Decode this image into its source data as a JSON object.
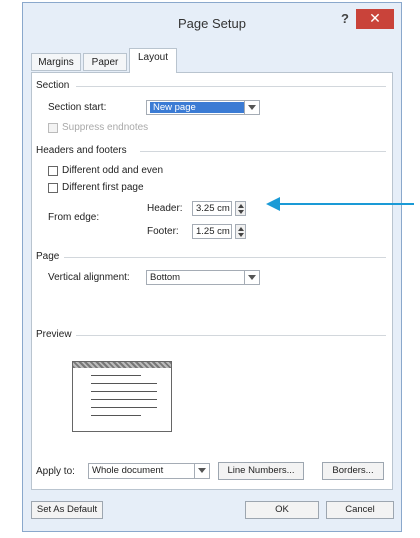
{
  "window": {
    "title": "Page Setup",
    "help": "?",
    "close": "✕"
  },
  "tabs": [
    {
      "label": "Margins",
      "active": false
    },
    {
      "label": "Paper",
      "active": false
    },
    {
      "label": "Layout",
      "active": true
    }
  ],
  "section": {
    "title": "Section",
    "start_label": "Section start:",
    "start_value": "New page",
    "suppress_label": "Suppress endnotes"
  },
  "headers_footers": {
    "title": "Headers and footers",
    "odd_even_label": "Different odd and even",
    "first_page_label": "Different first page",
    "from_edge_label": "From edge:",
    "header_label": "Header:",
    "header_value": "3.25 cm",
    "footer_label": "Footer:",
    "footer_value": "1.25 cm"
  },
  "page": {
    "title": "Page",
    "valign_label": "Vertical alignment:",
    "valign_value": "Bottom"
  },
  "preview": {
    "title": "Preview"
  },
  "apply": {
    "label": "Apply to:",
    "value": "Whole document",
    "line_numbers": "Line Numbers...",
    "borders": "Borders..."
  },
  "footer_buttons": {
    "set_default": "Set As Default",
    "ok": "OK",
    "cancel": "Cancel"
  },
  "colors": {
    "selection": "#3b7bd4",
    "close": "#c9433a",
    "annotation_arrow": "#1a9ad6"
  },
  "icons": {
    "help": "question-icon",
    "close": "close-icon",
    "arrow": "callout-arrow-icon"
  }
}
